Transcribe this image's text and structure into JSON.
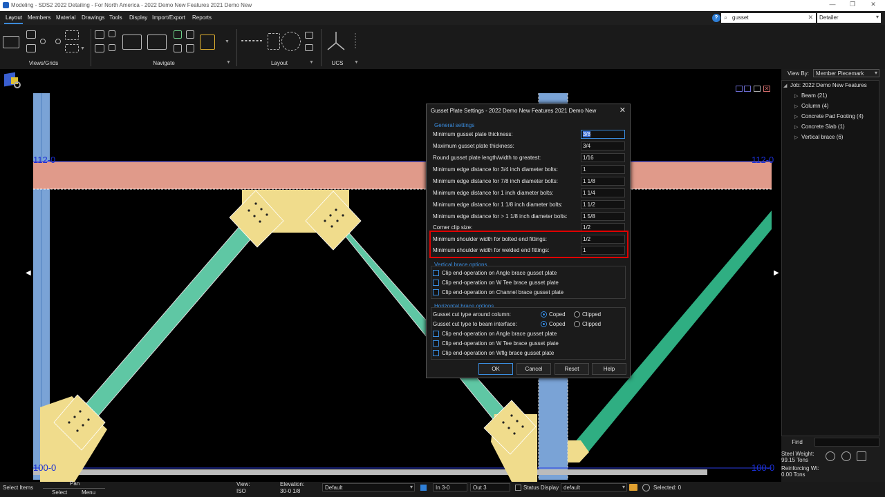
{
  "window": {
    "title": "Modeling - SDS2 2022 Detailing - For North America - 2022 Demo New Features 2021 Demo New"
  },
  "menu": {
    "items": [
      "Layout",
      "Members",
      "Material",
      "Drawings",
      "Tools",
      "Display",
      "Import/Export",
      "Reports"
    ],
    "active": "Layout",
    "search_value": "gusset",
    "role": "Detailer"
  },
  "ribbon": {
    "groups": [
      "Views/Grids",
      "Navigate",
      "Layout",
      "UCS"
    ]
  },
  "viewport": {
    "elev_top": "112-0",
    "elev_bottom": "100-0"
  },
  "right_panel": {
    "view_by_label": "View By:",
    "view_by_value": "Member Piecemark",
    "tree": [
      {
        "label": "Job: 2022 Demo New Features",
        "level": 0
      },
      {
        "label": "Beam (21)",
        "level": 1
      },
      {
        "label": "Column (4)",
        "level": 1
      },
      {
        "label": "Concrete Pad Footing (4)",
        "level": 1
      },
      {
        "label": "Concrete Slab (1)",
        "level": 1
      },
      {
        "label": "Vertical brace (6)",
        "level": 1
      }
    ],
    "find_label": "Find",
    "steel_weight_label": "Steel Weight:",
    "steel_weight_value": "99.15 Tons",
    "reinforcing_label": "Reinforcing Wt:",
    "reinforcing_value": "0.00 Tons"
  },
  "status_bar": {
    "select_items": "Select Items",
    "pan": "Pan",
    "select": "Select",
    "menu": "Menu",
    "view_label": "View:",
    "view_value": "ISO",
    "elevation_label": "Elevation:",
    "elevation_value": "30-0 1/8",
    "default_select": "Default",
    "in_value": "In 3-0",
    "out_value": "Out 3",
    "status_display": "Status Display",
    "status_select": "default",
    "selected": "Selected: 0"
  },
  "dialog": {
    "title": "Gusset Plate Settings - 2022 Demo New Features 2021 Demo New",
    "general_title": "General settings",
    "general_fields": [
      {
        "label": "Minimum gusset plate thickness:",
        "value": "3/8"
      },
      {
        "label": "Maximum gusset plate thickness:",
        "value": "3/4"
      },
      {
        "label": "Round gusset plate length/width to greatest:",
        "value": "1/16"
      },
      {
        "label": "Minimum edge distance for 3/4 inch diameter bolts:",
        "value": "1"
      },
      {
        "label": "Minimum edge distance for 7/8 inch diameter bolts:",
        "value": "1 1/8"
      },
      {
        "label": "Minimum edge distance for 1 inch diameter bolts:",
        "value": "1 1/4"
      },
      {
        "label": "Minimum edge distance for 1 1/8 inch diameter bolts:",
        "value": "1 1/2"
      },
      {
        "label": "Minimum edge distance for > 1 1/8 inch diameter bolts:",
        "value": "1 5/8"
      },
      {
        "label": "Corner clip size:",
        "value": "1/2"
      },
      {
        "label": "Minimum shoulder width for bolted end fittings:",
        "value": "1/2"
      },
      {
        "label": "Minimum shoulder width for welded end fittings:",
        "value": "1"
      }
    ],
    "vertical_title": "Vertical brace options",
    "vertical_options": [
      "Clip end-operation on Angle brace gusset plate",
      "Clip end-operation on W Tee brace gusset plate",
      "Clip end-operation on Channel brace gusset plate"
    ],
    "horizontal_title": "Horizontal brace options",
    "radio_rows": [
      {
        "label": "Gusset cut type around column:",
        "opt1": "Coped",
        "opt2": "Clipped"
      },
      {
        "label": "Gusset cut type to beam interface:",
        "opt1": "Coped",
        "opt2": "Clipped"
      }
    ],
    "horizontal_options": [
      "Clip end-operation on Angle brace gusset plate",
      "Clip end-operation on W Tee brace gusset plate",
      "Clip end-operation on Wflg brace gusset plate"
    ],
    "buttons": {
      "ok": "OK",
      "cancel": "Cancel",
      "reset": "Reset",
      "help": "Help"
    }
  },
  "colors": {
    "beam": "#e09a8a",
    "gusset": "#f0dc8c",
    "brace": "#5fc7a4",
    "column": "#7aa3d6",
    "accent": "#3a8de0",
    "highlight": "#e00000"
  }
}
